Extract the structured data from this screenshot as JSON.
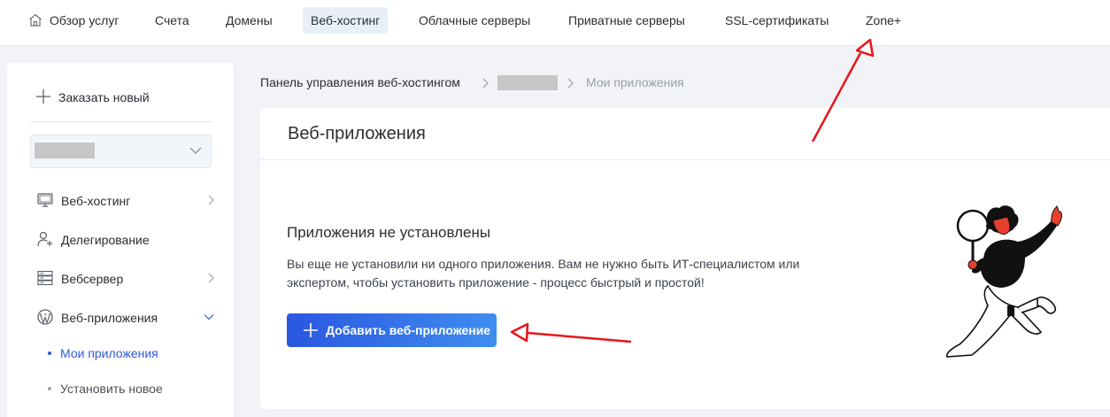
{
  "topnav": {
    "items": [
      {
        "label": "Обзор услуг"
      },
      {
        "label": "Счета"
      },
      {
        "label": "Домены"
      },
      {
        "label": "Веб-хостинг"
      },
      {
        "label": "Облачные серверы"
      },
      {
        "label": "Приватные серверы"
      },
      {
        "label": "SSL-сертификаты"
      },
      {
        "label": "Zone+"
      }
    ],
    "active": "Веб-хостинг"
  },
  "sidebar": {
    "order_new": "Заказать новый",
    "items": [
      {
        "label": "Веб-хостинг",
        "icon": "monitor-icon",
        "expandable": true
      },
      {
        "label": "Делегирование",
        "icon": "user-add-icon",
        "expandable": false
      },
      {
        "label": "Вебсервер",
        "icon": "server-icon",
        "expandable": true
      },
      {
        "label": "Веб-приложения",
        "icon": "wordpress-icon",
        "expandable": true,
        "expanded": true
      }
    ],
    "subitems": [
      {
        "label": "Мои приложения",
        "active": true
      },
      {
        "label": "Установить новое",
        "active": false
      }
    ]
  },
  "breadcrumb": {
    "root": "Панель управления веб-хостингом",
    "current": "Мои приложения"
  },
  "main": {
    "title": "Веб-приложения",
    "empty_title": "Приложения не установлены",
    "empty_desc": "Вы еще не установили ни одного приложения. Вам не нужно быть ИТ-специалистом или экспертом, чтобы установить приложение - процесс быстрый и простой!",
    "add_button": "Добавить веб-приложение"
  },
  "colors": {
    "accent": "#2e5bd8",
    "button_start": "#2a57e0",
    "button_end": "#3f8df0",
    "annotation": "#e8151b"
  }
}
